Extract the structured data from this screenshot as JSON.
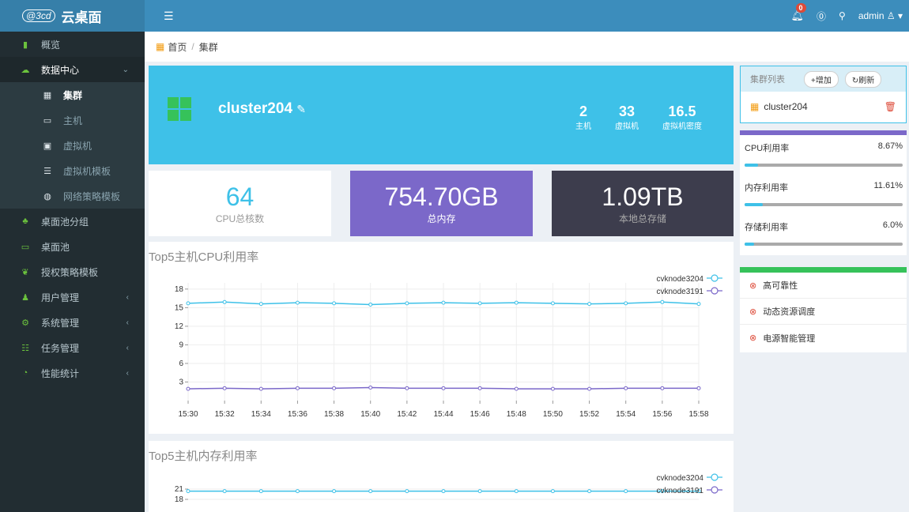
{
  "app": {
    "logo_mark": "@3cd",
    "name": "云桌面"
  },
  "sidebar": {
    "items": [
      {
        "label": "概览",
        "icon": "bar-chart-icon"
      },
      {
        "label": "数据中心",
        "icon": "cloud-icon"
      },
      {
        "label": "集群",
        "icon": "grid-icon"
      },
      {
        "label": "主机",
        "icon": "monitor-icon"
      },
      {
        "label": "虚拟机",
        "icon": "vm-icon"
      },
      {
        "label": "虚拟机模板",
        "icon": "list-icon"
      },
      {
        "label": "网络策略模板",
        "icon": "globe-icon"
      },
      {
        "label": "桌面池分组",
        "icon": "cubes-icon"
      },
      {
        "label": "桌面池",
        "icon": "laptop-icon"
      },
      {
        "label": "授权策略模板",
        "icon": "leaf-icon"
      },
      {
        "label": "用户管理",
        "icon": "users-icon"
      },
      {
        "label": "系统管理",
        "icon": "gear-icon"
      },
      {
        "label": "任务管理",
        "icon": "tasks-icon"
      },
      {
        "label": "性能统计",
        "icon": "gauge-icon"
      }
    ]
  },
  "header": {
    "alert_count": "0",
    "user": "admin"
  },
  "breadcrumb": {
    "home": "首页",
    "sep": "/",
    "current": "集群"
  },
  "banner": {
    "title": "cluster204",
    "stats": [
      {
        "value": "2",
        "label": "主机"
      },
      {
        "value": "33",
        "label": "虚拟机"
      },
      {
        "value": "16.5",
        "label": "虚拟机密度"
      }
    ]
  },
  "cards": [
    {
      "value": "64",
      "label": "CPU总核数"
    },
    {
      "value": "754.70GB",
      "label": "总内存"
    },
    {
      "value": "1.09TB",
      "label": "本地总存储"
    }
  ],
  "cpu_panel": {
    "title": "Top5主机CPU利用率"
  },
  "mem_panel": {
    "title": "Top5主机内存利用率"
  },
  "chart_data": [
    {
      "type": "line",
      "title": "Top5主机CPU利用率",
      "x": [
        "15:30",
        "15:32",
        "15:34",
        "15:36",
        "15:38",
        "15:40",
        "15:42",
        "15:44",
        "15:46",
        "15:48",
        "15:50",
        "15:52",
        "15:54",
        "15:56",
        "15:58"
      ],
      "yticks": [
        3,
        6,
        9,
        12,
        15,
        18
      ],
      "ylim": [
        0,
        19
      ],
      "series": [
        {
          "name": "cvknode3204",
          "color": "#3ec1e8",
          "values": [
            15.7,
            15.9,
            15.6,
            15.8,
            15.7,
            15.5,
            15.7,
            15.8,
            15.7,
            15.8,
            15.7,
            15.6,
            15.7,
            15.9,
            15.6
          ]
        },
        {
          "name": "cvknode3191",
          "color": "#7b68c9",
          "values": [
            1.9,
            2.0,
            1.9,
            2.0,
            2.0,
            2.1,
            2.0,
            2.0,
            2.0,
            1.9,
            1.9,
            1.9,
            2.0,
            2.0,
            2.0
          ]
        }
      ],
      "legend": "top-right"
    },
    {
      "type": "line",
      "title": "Top5主机内存利用率",
      "yticks": [
        18,
        21
      ],
      "series": [
        {
          "name": "cvknode3204",
          "color": "#3ec1e8",
          "values": [
            20.4,
            20.4,
            20.4,
            20.4,
            20.4,
            20.4,
            20.4,
            20.4,
            20.4,
            20.4,
            20.4,
            20.4,
            20.4,
            20.4,
            20.4
          ]
        },
        {
          "name": "cvknode3191",
          "color": "#7b68c9",
          "values": []
        }
      ],
      "legend": "top-right"
    }
  ],
  "cluster_list": {
    "title": "集群列表",
    "add": "+增加",
    "refresh": "刷新",
    "items": [
      "cluster204"
    ]
  },
  "metrics": [
    {
      "label": "CPU利用率",
      "value": "8.67%",
      "fraction": 0.0867
    },
    {
      "label": "内存利用率",
      "value": "11.61%",
      "fraction": 0.1161
    },
    {
      "label": "存储利用率",
      "value": "6.0%",
      "fraction": 0.06
    }
  ],
  "features": [
    "高可靠性",
    "动态资源调度",
    "电源智能管理"
  ],
  "colors": {
    "accent": "#3ec1e8",
    "purple": "#7b68c9",
    "dark": "#3d3d4d",
    "green": "#36c25a",
    "sidebar": "#222d32",
    "header": "#3c8dbc"
  }
}
